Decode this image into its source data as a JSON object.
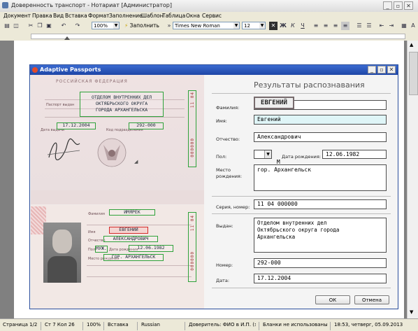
{
  "window": {
    "title": "Доверенность транспорт - Нотариат [Администратор]"
  },
  "menu": [
    "Документ",
    "Правка",
    "Вид",
    "Вставка",
    "Формат",
    "Заполнение",
    "Шаблон",
    "Таблица",
    "Окна",
    "Сервис"
  ],
  "toolbar": {
    "zoom": "100%",
    "fill_label": "Заполнить",
    "font": "Times New Roman",
    "size": "12",
    "bold": "Ж",
    "italic": "К",
    "underline": "Ч"
  },
  "statusbar": {
    "page": "Страница 1/2",
    "pos": "Ст 7  Кол 26",
    "zoom": "100%",
    "mode": "Вставка",
    "lang": "Russian",
    "info": "Доверитель: ФИО в И.П. (заявит...",
    "blanks": "Бланки не использованы",
    "time": "18:53, четверг, 05.09.2013"
  },
  "dialog": {
    "title": "Adaptive Passports",
    "heading": "Результаты распознавания",
    "surname_label": "Фамилия:",
    "surname_value": "ЕВГЕНИЙ",
    "name_label": "Имя:",
    "name_value": "Евгений",
    "patronymic_label": "Отчество:",
    "patronymic_value": "Александрович",
    "sex_label": "Пол:",
    "sex_value": "М",
    "birthdate_label": "Дата рождения:",
    "birthdate_value": "12.06.1982",
    "birthplace_label": "Место рождения:",
    "birthplace_value": "гор. Архангельск",
    "series_label": "Серия, номер:",
    "series_value": "11 04 000000",
    "issued_label": "Выдан:",
    "issued_value": "Отделом внутренних дел\nОктябрьского округа города\nАрхангельска",
    "code_label": "Номер:",
    "code_value": "292-000",
    "date_label": "Дата:",
    "date_value": "17.12.2004",
    "ok": "ОК",
    "cancel": "Отмена"
  },
  "passport": {
    "country": "РОССИЙСКАЯ ФЕДЕРАЦИЯ",
    "issuer": "ОТДЕЛОМ ВНУТРЕННИХ ДЕЛ\nОКТЯБРЬСКОГО ОКРУГА\nГОРОДА АРХАНГЕЛЬСКА",
    "issue_date": "17.12.2004",
    "code": "292-000",
    "surname": "ИМЯРЕК",
    "name": "ЕВГЕНИЙ",
    "patronymic": "АЛЕКСАНДРОВИЧ",
    "sex": "МУЖ.",
    "birth_date": "12.06.1982",
    "birth_place": "ГОР. АРХАНГЕЛЬСК",
    "series_top": "11 04",
    "number_top": "000000",
    "label_issuer": "Паспорт выдан",
    "label_date": "Дата выдачи",
    "label_code": "Код подразделения",
    "label_surname": "Фамилия",
    "label_name": "Имя",
    "label_patronymic": "Отчество",
    "label_sex": "Пол",
    "label_bdate": "Дата рождения",
    "label_bplace": "Место рождения"
  }
}
